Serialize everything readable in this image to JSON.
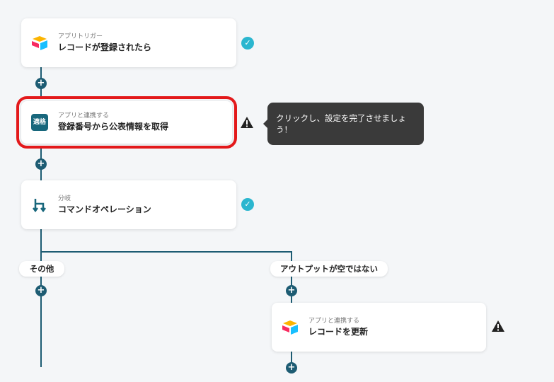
{
  "steps": [
    {
      "sub": "アプリトリガー",
      "title": "レコードが登録されたら",
      "icon": "airtable-icon",
      "status": "complete"
    },
    {
      "sub": "アプリと連携する",
      "title": "登録番号から公表情報を取得",
      "icon": "tekikaku-icon",
      "icon_text": "適格",
      "status": "warning"
    },
    {
      "sub": "分岐",
      "title": "コマンドオペレーション",
      "icon": "branch-icon",
      "status": "complete"
    },
    {
      "sub": "アプリと連携する",
      "title": "レコードを更新",
      "icon": "airtable-icon",
      "status": "warning"
    }
  ],
  "tooltip": {
    "text": "クリックし、設定を完了させましょう！"
  },
  "branches": {
    "left": "その他",
    "right": "アウトプットが空ではない"
  },
  "status_icons": {
    "check": "✓",
    "plus": "+"
  },
  "colors": {
    "accent": "#1d5c73",
    "check": "#2bb6cf",
    "highlight": "#e3191b",
    "tooltip_bg": "#3a3a3a"
  }
}
